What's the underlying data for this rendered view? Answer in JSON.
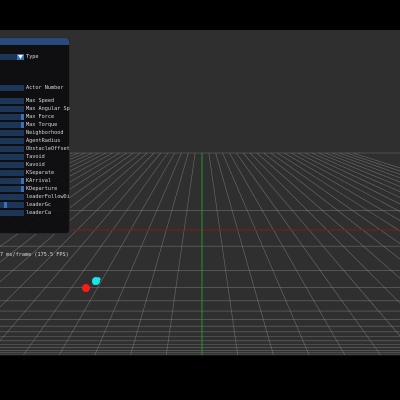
{
  "scene": {
    "background": "#2f2f2f",
    "grid_color": "#9a9a9a",
    "x_axis_color": "#7a1d1d",
    "z_axis_color": "#1f9a28",
    "agents": [
      {
        "name": "red-agent",
        "color": "#ff1a1a"
      },
      {
        "name": "cyan-agent",
        "color": "#19e6e6"
      }
    ]
  },
  "panel": {
    "type_label": "Type",
    "actor_number_label": "Actor Number",
    "params": [
      {
        "label": "Max Speed"
      },
      {
        "label": "Max Angular Spee",
        "clipped": true
      },
      {
        "label": "Max Force"
      },
      {
        "label": "Max Torque"
      },
      {
        "label": "Neighborhood"
      },
      {
        "label": "AgentRadius"
      },
      {
        "label": "ObstacleOffset"
      },
      {
        "label": "Tavoid"
      },
      {
        "label": "Kavoid"
      },
      {
        "label": "KSeparate"
      },
      {
        "label": "KArrival"
      },
      {
        "label": "KDeparture"
      },
      {
        "label": "leaderFollowDist",
        "clipped": true
      },
      {
        "label": "leaderGc"
      },
      {
        "label": "leaderCa"
      }
    ],
    "fps_text": "7 ms/frame (175.5 FPS)"
  }
}
